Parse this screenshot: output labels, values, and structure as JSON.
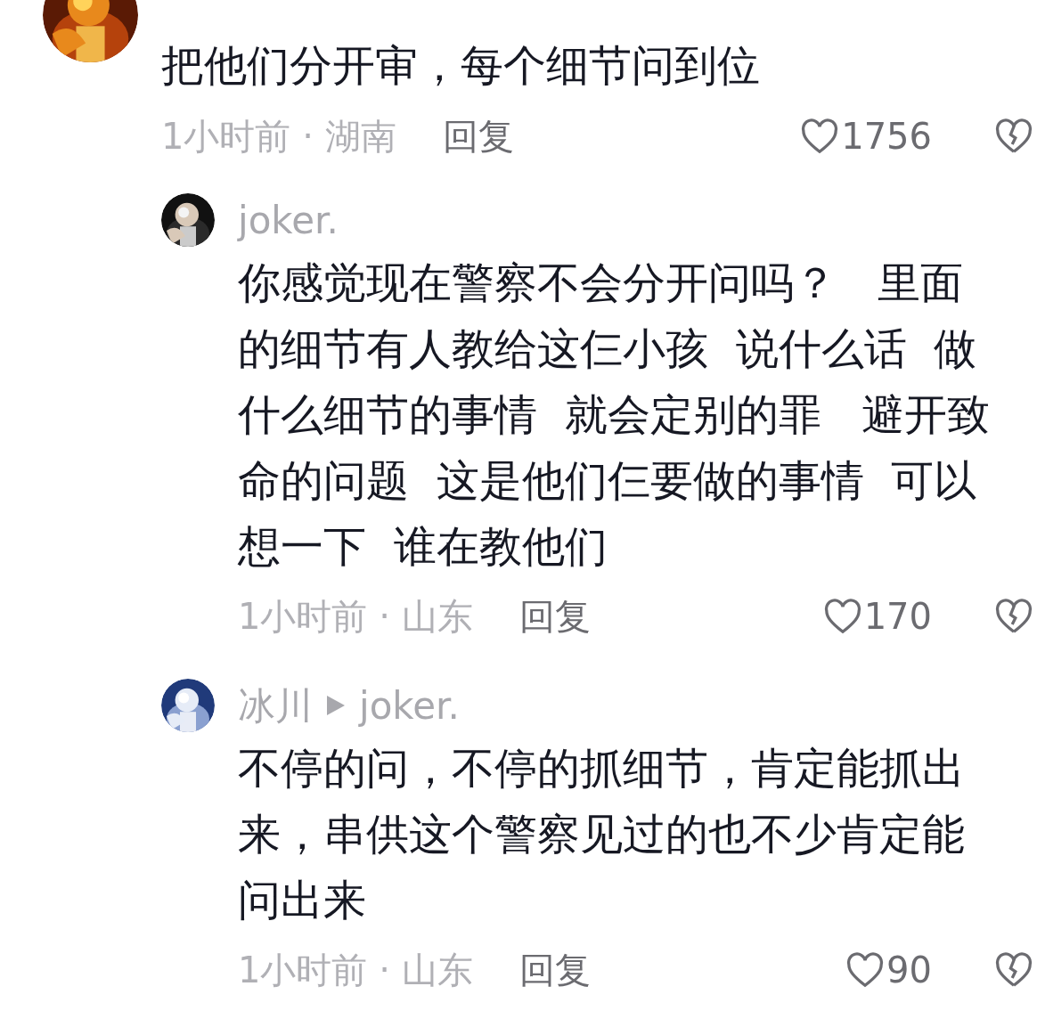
{
  "comments": [
    {
      "text": "把他们分开审，每个细节问到位",
      "time_place": "1小时前 · 湖南",
      "reply_label": "回复",
      "likes": "1756",
      "replies": [
        {
          "name": "joker.",
          "text": "你感觉现在警察不会分开问吗？   里面的细节有人教给这仨小孩  说什么话  做什么细节的事情  就会定别的罪   避开致命的问题  这是他们仨要做的事情  可以想一下  谁在教他们",
          "time_place": "1小时前 · 山东",
          "reply_label": "回复",
          "likes": "170"
        },
        {
          "name": "冰川",
          "reply_to": "joker.",
          "text": "不停的问，不停的抓细节，肯定能抓出来，串供这个警察见过的也不少肯定能问出来",
          "time_place": "1小时前 · 山东",
          "reply_label": "回复",
          "likes": "90"
        }
      ]
    }
  ]
}
